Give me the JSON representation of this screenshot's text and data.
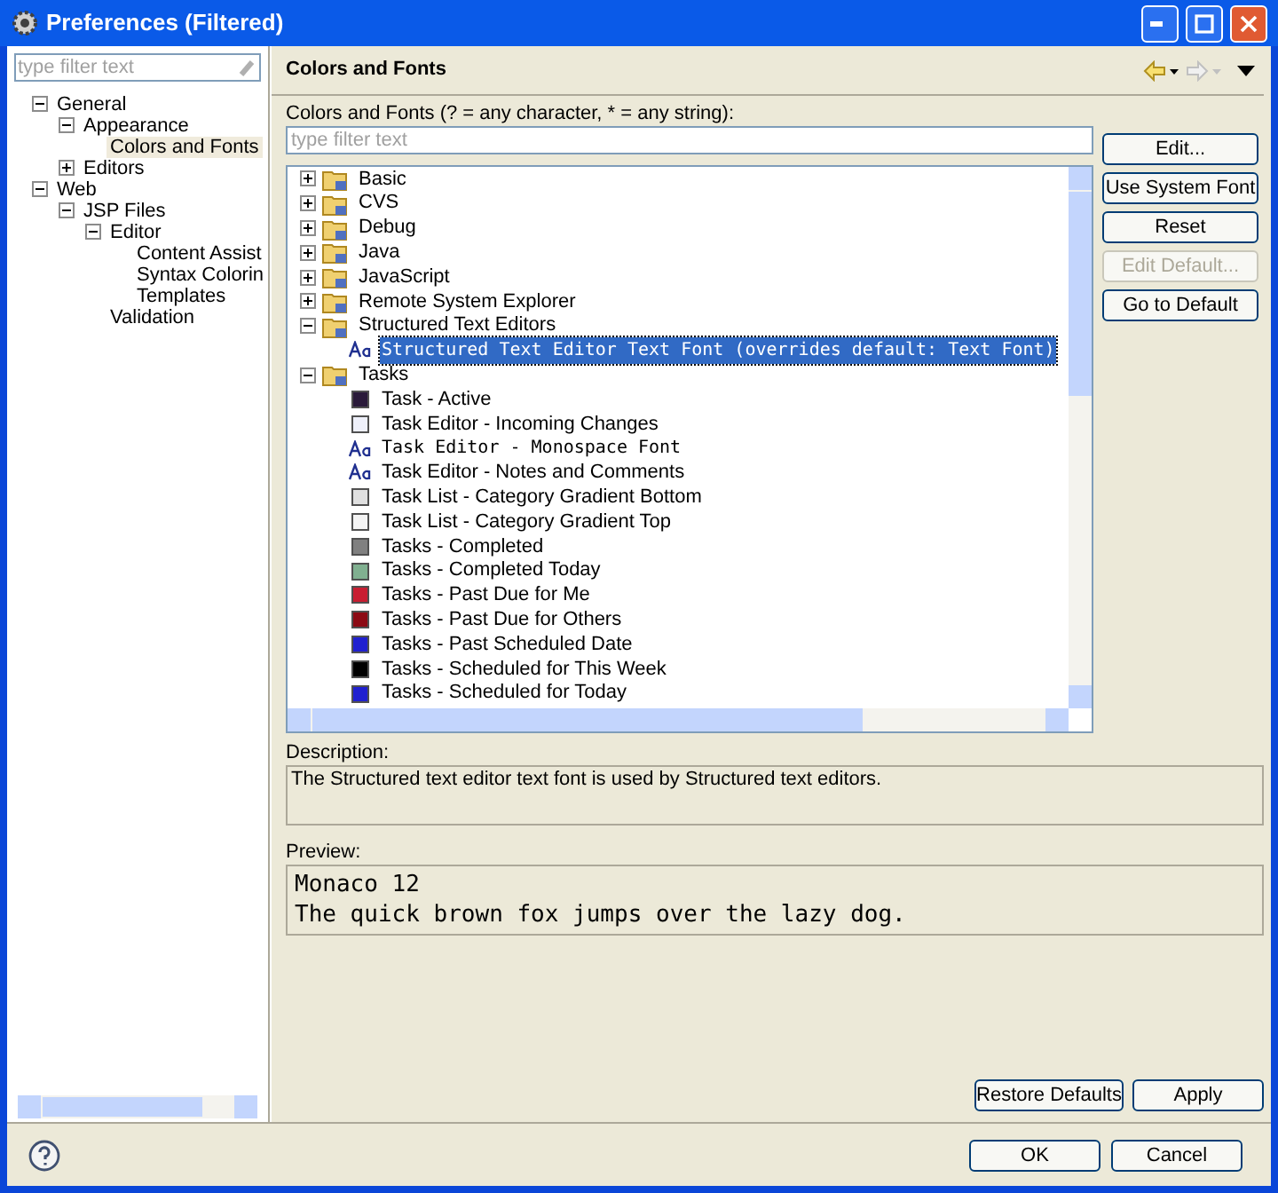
{
  "window": {
    "title": "Preferences (Filtered)"
  },
  "sidebar": {
    "filter": {
      "placeholder": "type filter text"
    },
    "items": [
      {
        "label": "General",
        "expanded": true,
        "selected": false,
        "children": [
          {
            "label": "Appearance",
            "expanded": true,
            "selected": false,
            "children": [
              {
                "label": "Colors and Fonts",
                "selected": true
              }
            ]
          },
          {
            "label": "Editors",
            "expanded": false,
            "selected": false
          }
        ]
      },
      {
        "label": "Web",
        "expanded": true,
        "selected": false,
        "children": [
          {
            "label": "JSP Files",
            "expanded": true,
            "selected": false,
            "children": [
              {
                "label": "Editor",
                "expanded": true,
                "selected": false,
                "children": [
                  {
                    "label": "Content Assist",
                    "selected": false
                  },
                  {
                    "label": "Syntax Colorin",
                    "selected": false
                  },
                  {
                    "label": "Templates",
                    "selected": false
                  }
                ]
              },
              {
                "label": "Validation",
                "selected": false
              }
            ]
          }
        ]
      }
    ]
  },
  "page": {
    "title": "Colors and Fonts",
    "filter_label": "Colors and Fonts (? = any character, * = any string):",
    "filter": {
      "placeholder": "type filter text"
    },
    "tree": [
      {
        "label": "Basic",
        "expanded": false
      },
      {
        "label": "CVS",
        "expanded": false
      },
      {
        "label": "Debug",
        "expanded": false
      },
      {
        "label": "Java",
        "expanded": false
      },
      {
        "label": "JavaScript",
        "expanded": false
      },
      {
        "label": "Remote System Explorer",
        "expanded": false
      },
      {
        "label": "Structured Text Editors",
        "expanded": true,
        "children": [
          {
            "kind": "font",
            "label": "Structured Text Editor Text Font (overrides default: Text Font)",
            "mono": true,
            "selected": true
          }
        ]
      },
      {
        "label": "Tasks",
        "expanded": true,
        "children": [
          {
            "kind": "color",
            "label": "Task - Active",
            "color": "#2a1a3a",
            "selected": false
          },
          {
            "kind": "color",
            "label": "Task Editor - Incoming Changes",
            "color": "#eef0fa",
            "selected": false
          },
          {
            "kind": "font",
            "label": "Task Editor - Monospace Font",
            "mono": true,
            "selected": false
          },
          {
            "kind": "font",
            "label": "Task Editor - Notes and Comments",
            "mono": false,
            "selected": false
          },
          {
            "kind": "color",
            "label": "Task List - Category Gradient Bottom",
            "color": "#e0e0e0",
            "selected": false
          },
          {
            "kind": "color",
            "label": "Task List - Category Gradient Top",
            "color": "#f4f4f4",
            "selected": false
          },
          {
            "kind": "color",
            "label": "Tasks - Completed",
            "color": "#808080",
            "selected": false
          },
          {
            "kind": "color",
            "label": "Tasks - Completed Today",
            "color": "#80b090",
            "selected": false
          },
          {
            "kind": "color",
            "label": "Tasks - Past Due for Me",
            "color": "#c81e32",
            "selected": false
          },
          {
            "kind": "color",
            "label": "Tasks - Past Due for Others",
            "color": "#8c0a14",
            "selected": false
          },
          {
            "kind": "color",
            "label": "Tasks - Past Scheduled Date",
            "color": "#2020d0",
            "selected": false
          },
          {
            "kind": "color",
            "label": "Tasks - Scheduled for This Week",
            "color": "#000000",
            "selected": false
          },
          {
            "kind": "color",
            "label": "Tasks - Scheduled for Today",
            "color": "#2020d0",
            "selected": false
          }
        ]
      }
    ],
    "side_buttons": [
      {
        "label": "Edit...",
        "disabled": false
      },
      {
        "label": "Use System Font",
        "disabled": false
      },
      {
        "label": "Reset",
        "disabled": false
      },
      {
        "label": "Edit Default...",
        "disabled": true
      },
      {
        "label": "Go to Default",
        "disabled": false
      }
    ],
    "description_label": "Description:",
    "description": "The Structured text editor text font is used by Structured text editors.",
    "preview_label": "Preview:",
    "preview_lines": [
      "Monaco 12",
      "The quick brown fox jumps over the lazy dog."
    ],
    "page_buttons": [
      "Restore Defaults",
      "Apply"
    ]
  },
  "dialog_buttons": [
    "OK",
    "Cancel"
  ]
}
